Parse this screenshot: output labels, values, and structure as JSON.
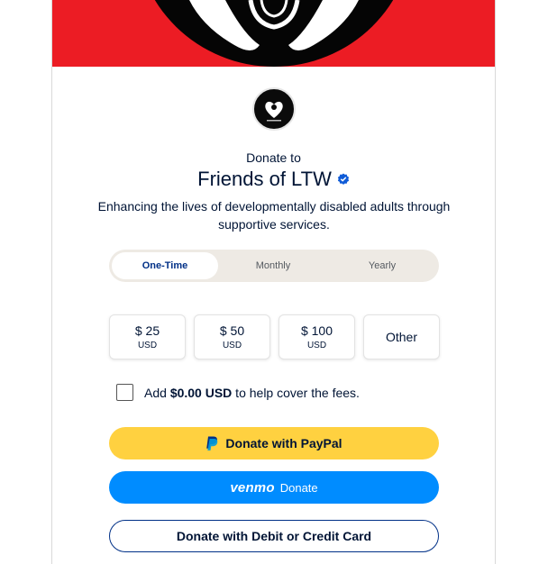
{
  "banner": {
    "background_color": "#ec1c24",
    "image_name": "hands-heart-logo-image"
  },
  "org": {
    "donate_to": "Donate to",
    "name": "Friends of LTW",
    "verified_icon": "verified-badge-icon",
    "tagline": "Enhancing the lives of developmentally disabled adults through supportive services."
  },
  "frequency": {
    "tabs": [
      {
        "label": "One-Time",
        "selected": true
      },
      {
        "label": "Monthly",
        "selected": false
      },
      {
        "label": "Yearly",
        "selected": false
      }
    ]
  },
  "amounts": [
    {
      "value": "$ 25",
      "currency": "USD"
    },
    {
      "value": "$ 50",
      "currency": "USD"
    },
    {
      "value": "$ 100",
      "currency": "USD"
    },
    {
      "value": "Other"
    }
  ],
  "fees": {
    "checked": false,
    "prefix": "Add ",
    "amount": "$0.00 USD",
    "suffix": " to help cover the fees."
  },
  "buttons": {
    "paypal": {
      "label": "Donate with PayPal",
      "icon": "paypal-icon",
      "color": "#ffd140"
    },
    "venmo": {
      "logo": "venmo",
      "label": "Donate",
      "color": "#008cff"
    },
    "card": {
      "label": "Donate with Debit or Credit Card",
      "border_color": "#003087"
    }
  }
}
